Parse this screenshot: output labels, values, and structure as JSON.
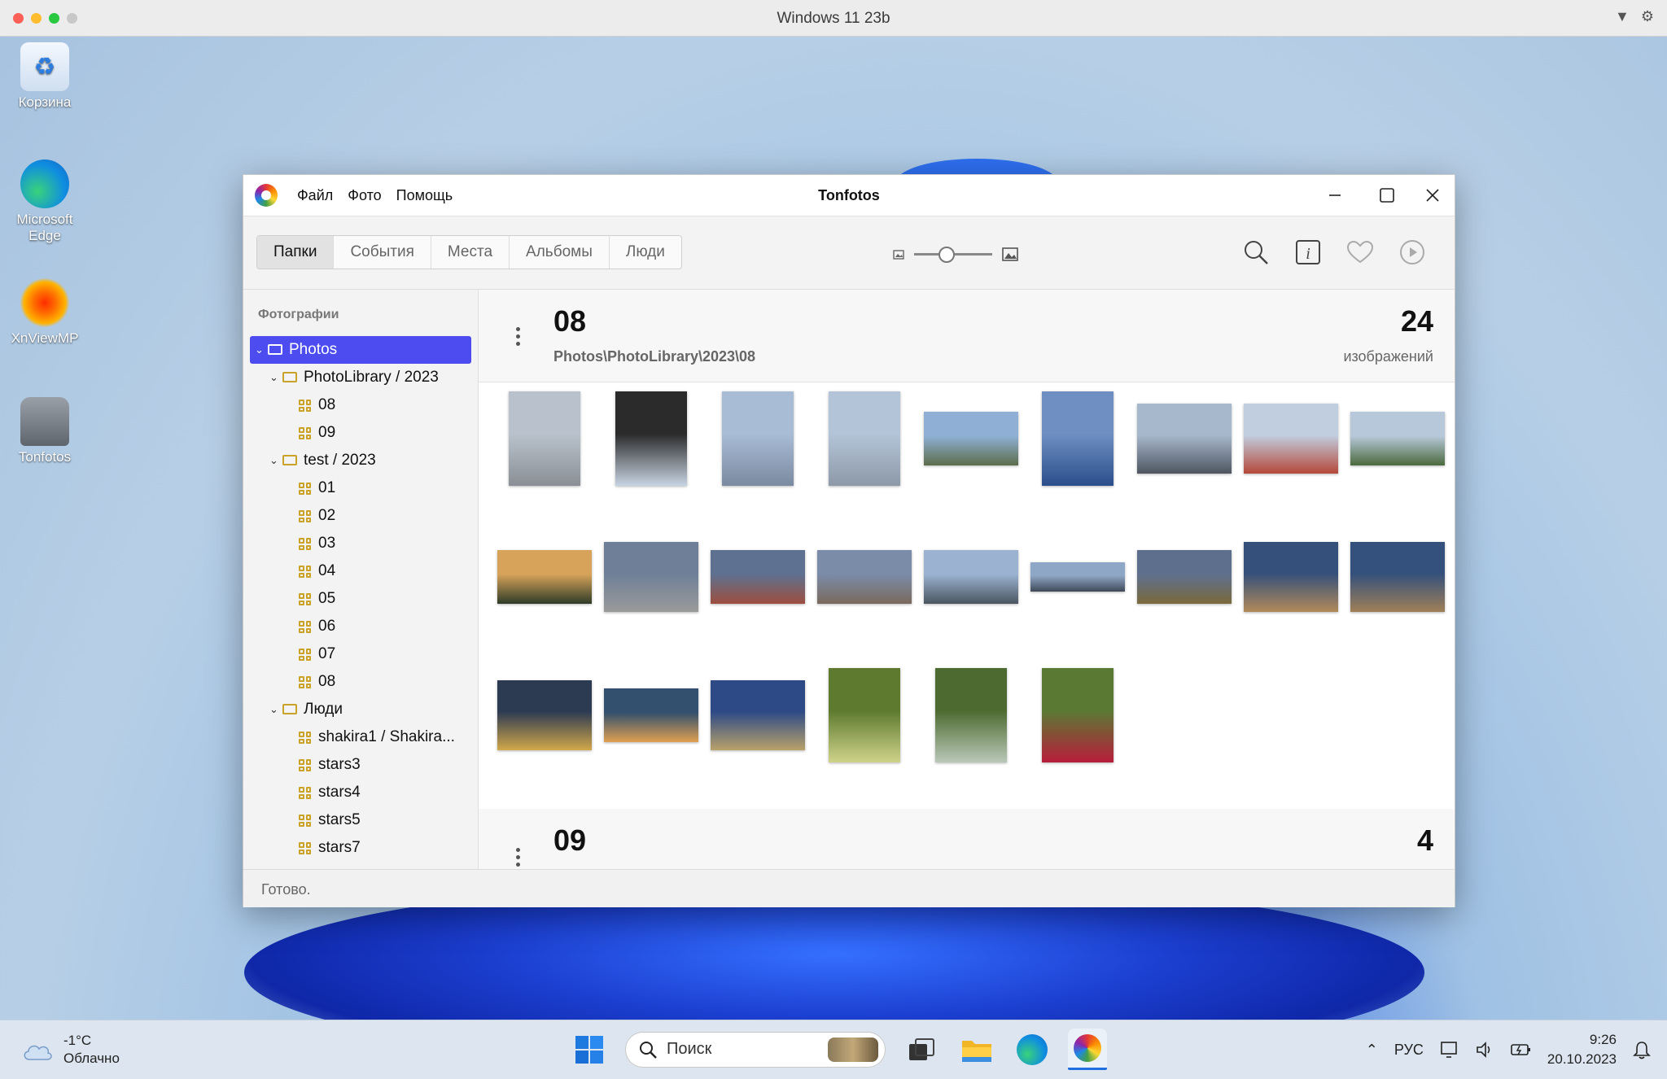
{
  "host": {
    "title": "Windows 11 23b"
  },
  "desktop": {
    "icons": [
      {
        "label": "Корзина"
      },
      {
        "label": "Microsoft Edge"
      },
      {
        "label": "XnViewMP"
      },
      {
        "label": "Tonfotos"
      }
    ]
  },
  "window": {
    "title": "Tonfotos",
    "menu": [
      "Файл",
      "Фото",
      "Помощь"
    ],
    "tabs": [
      "Папки",
      "События",
      "Места",
      "Альбомы",
      "Люди"
    ],
    "active_tab": "Папки",
    "zoom_level": 0.4
  },
  "sidebar": {
    "heading": "Фотографии",
    "tree": [
      {
        "label": "Photos",
        "type": "folder",
        "level": 0,
        "expanded": true,
        "selected": true
      },
      {
        "label": "PhotoLibrary / 2023",
        "type": "folder",
        "level": 1,
        "expanded": true
      },
      {
        "label": "08",
        "type": "album",
        "level": 2
      },
      {
        "label": "09",
        "type": "album",
        "level": 2
      },
      {
        "label": "test / 2023",
        "type": "folder",
        "level": 1,
        "expanded": true
      },
      {
        "label": "01",
        "type": "album",
        "level": 2
      },
      {
        "label": "02",
        "type": "album",
        "level": 2
      },
      {
        "label": "03",
        "type": "album",
        "level": 2
      },
      {
        "label": "04",
        "type": "album",
        "level": 2
      },
      {
        "label": "05",
        "type": "album",
        "level": 2
      },
      {
        "label": "06",
        "type": "album",
        "level": 2
      },
      {
        "label": "07",
        "type": "album",
        "level": 2
      },
      {
        "label": "08",
        "type": "album",
        "level": 2
      },
      {
        "label": "Люди",
        "type": "folder",
        "level": 1,
        "expanded": true
      },
      {
        "label": "shakira1 / Shakira...",
        "type": "album",
        "level": 2
      },
      {
        "label": "stars3",
        "type": "album",
        "level": 2
      },
      {
        "label": "stars4",
        "type": "album",
        "level": 2
      },
      {
        "label": "stars5",
        "type": "album",
        "level": 2
      },
      {
        "label": "stars7",
        "type": "album",
        "level": 2
      }
    ]
  },
  "main": {
    "sections": [
      {
        "name": "08",
        "path": "Photos\\PhotoLibrary\\2023\\08",
        "count": "24",
        "count_label": "изображений"
      },
      {
        "name": "09",
        "path": "",
        "count": "4",
        "count_label": ""
      }
    ],
    "thumbnails": [
      {
        "orientation": "portrait",
        "colors": [
          "#b9c2cc",
          "#8a8f95"
        ]
      },
      {
        "orientation": "portrait",
        "colors": [
          "#2b2b2b",
          "#c7d4e2"
        ]
      },
      {
        "orientation": "portrait",
        "colors": [
          "#a9bcd6",
          "#7a8aa0"
        ]
      },
      {
        "orientation": "portrait",
        "colors": [
          "#b4c4d8",
          "#8d99a8"
        ]
      },
      {
        "orientation": "wide",
        "colors": [
          "#8fb0d4",
          "#5c6d4c"
        ]
      },
      {
        "orientation": "portrait",
        "colors": [
          "#6f8fc2",
          "#2b4f8c"
        ]
      },
      {
        "orientation": "landscape",
        "colors": [
          "#a7b8cc",
          "#4e5560"
        ]
      },
      {
        "orientation": "landscape",
        "colors": [
          "#c1cee0",
          "#b5483a"
        ]
      },
      {
        "orientation": "wide",
        "colors": [
          "#b7c8da",
          "#4b6a3e"
        ]
      },
      {
        "orientation": "wide",
        "colors": [
          "#d7a35a",
          "#2e3b28"
        ]
      },
      {
        "orientation": "landscape",
        "colors": [
          "#6f7f98",
          "#9a9a9a"
        ]
      },
      {
        "orientation": "wide",
        "colors": [
          "#5e7190",
          "#9d4e3e"
        ]
      },
      {
        "orientation": "wide",
        "colors": [
          "#7b8ca8",
          "#7a6a5c"
        ]
      },
      {
        "orientation": "wide",
        "colors": [
          "#9bb3d1",
          "#4a5560"
        ]
      },
      {
        "orientation": "thin",
        "colors": [
          "#8fa7c6",
          "#3f4a58"
        ]
      },
      {
        "orientation": "wide",
        "colors": [
          "#5e6f8e",
          "#7a6a3c"
        ]
      },
      {
        "orientation": "landscape",
        "colors": [
          "#35507a",
          "#b28a5a"
        ]
      },
      {
        "orientation": "landscape",
        "colors": [
          "#34507c",
          "#a07f58"
        ]
      },
      {
        "orientation": "landscape",
        "colors": [
          "#2d3b52",
          "#d2a84a"
        ]
      },
      {
        "orientation": "wide",
        "colors": [
          "#33506e",
          "#e0a050"
        ]
      },
      {
        "orientation": "landscape",
        "colors": [
          "#2e4a86",
          "#b9a26a"
        ]
      },
      {
        "orientation": "portrait",
        "colors": [
          "#5d7a2e",
          "#cfd38a"
        ]
      },
      {
        "orientation": "portrait",
        "colors": [
          "#4d6a30",
          "#b9c8b8"
        ]
      },
      {
        "orientation": "portrait",
        "colors": [
          "#5a7a34",
          "#b81d3a"
        ]
      }
    ]
  },
  "status": {
    "text": "Готово."
  },
  "taskbar": {
    "weather_temp": "-1°C",
    "weather_text": "Облачно",
    "search_placeholder": "Поиск",
    "language": "РУС",
    "time": "9:26",
    "date": "20.10.2023"
  },
  "colors": {
    "selection": "#4c4cf0",
    "folder_icon": "#c9a227"
  }
}
